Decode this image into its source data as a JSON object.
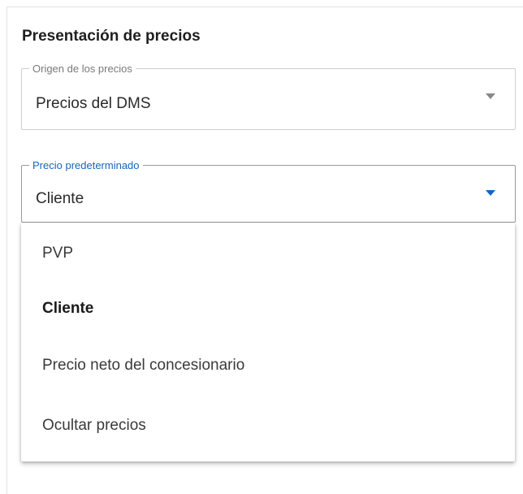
{
  "section": {
    "title": "Presentación de precios"
  },
  "price_source": {
    "label": "Origen de los precios",
    "value": "Precios del DMS",
    "caret_icon": "triangle-down-icon"
  },
  "default_price": {
    "label": "Precio predeterminado",
    "value": "Cliente",
    "caret_icon": "triangle-down-icon",
    "accent_color": "#1565c0",
    "options": [
      {
        "label": "PVP",
        "selected": false
      },
      {
        "label": "Cliente",
        "selected": true
      },
      {
        "label": "Precio neto del concesionario",
        "selected": false
      },
      {
        "label": "Ocultar precios",
        "selected": false
      }
    ]
  }
}
